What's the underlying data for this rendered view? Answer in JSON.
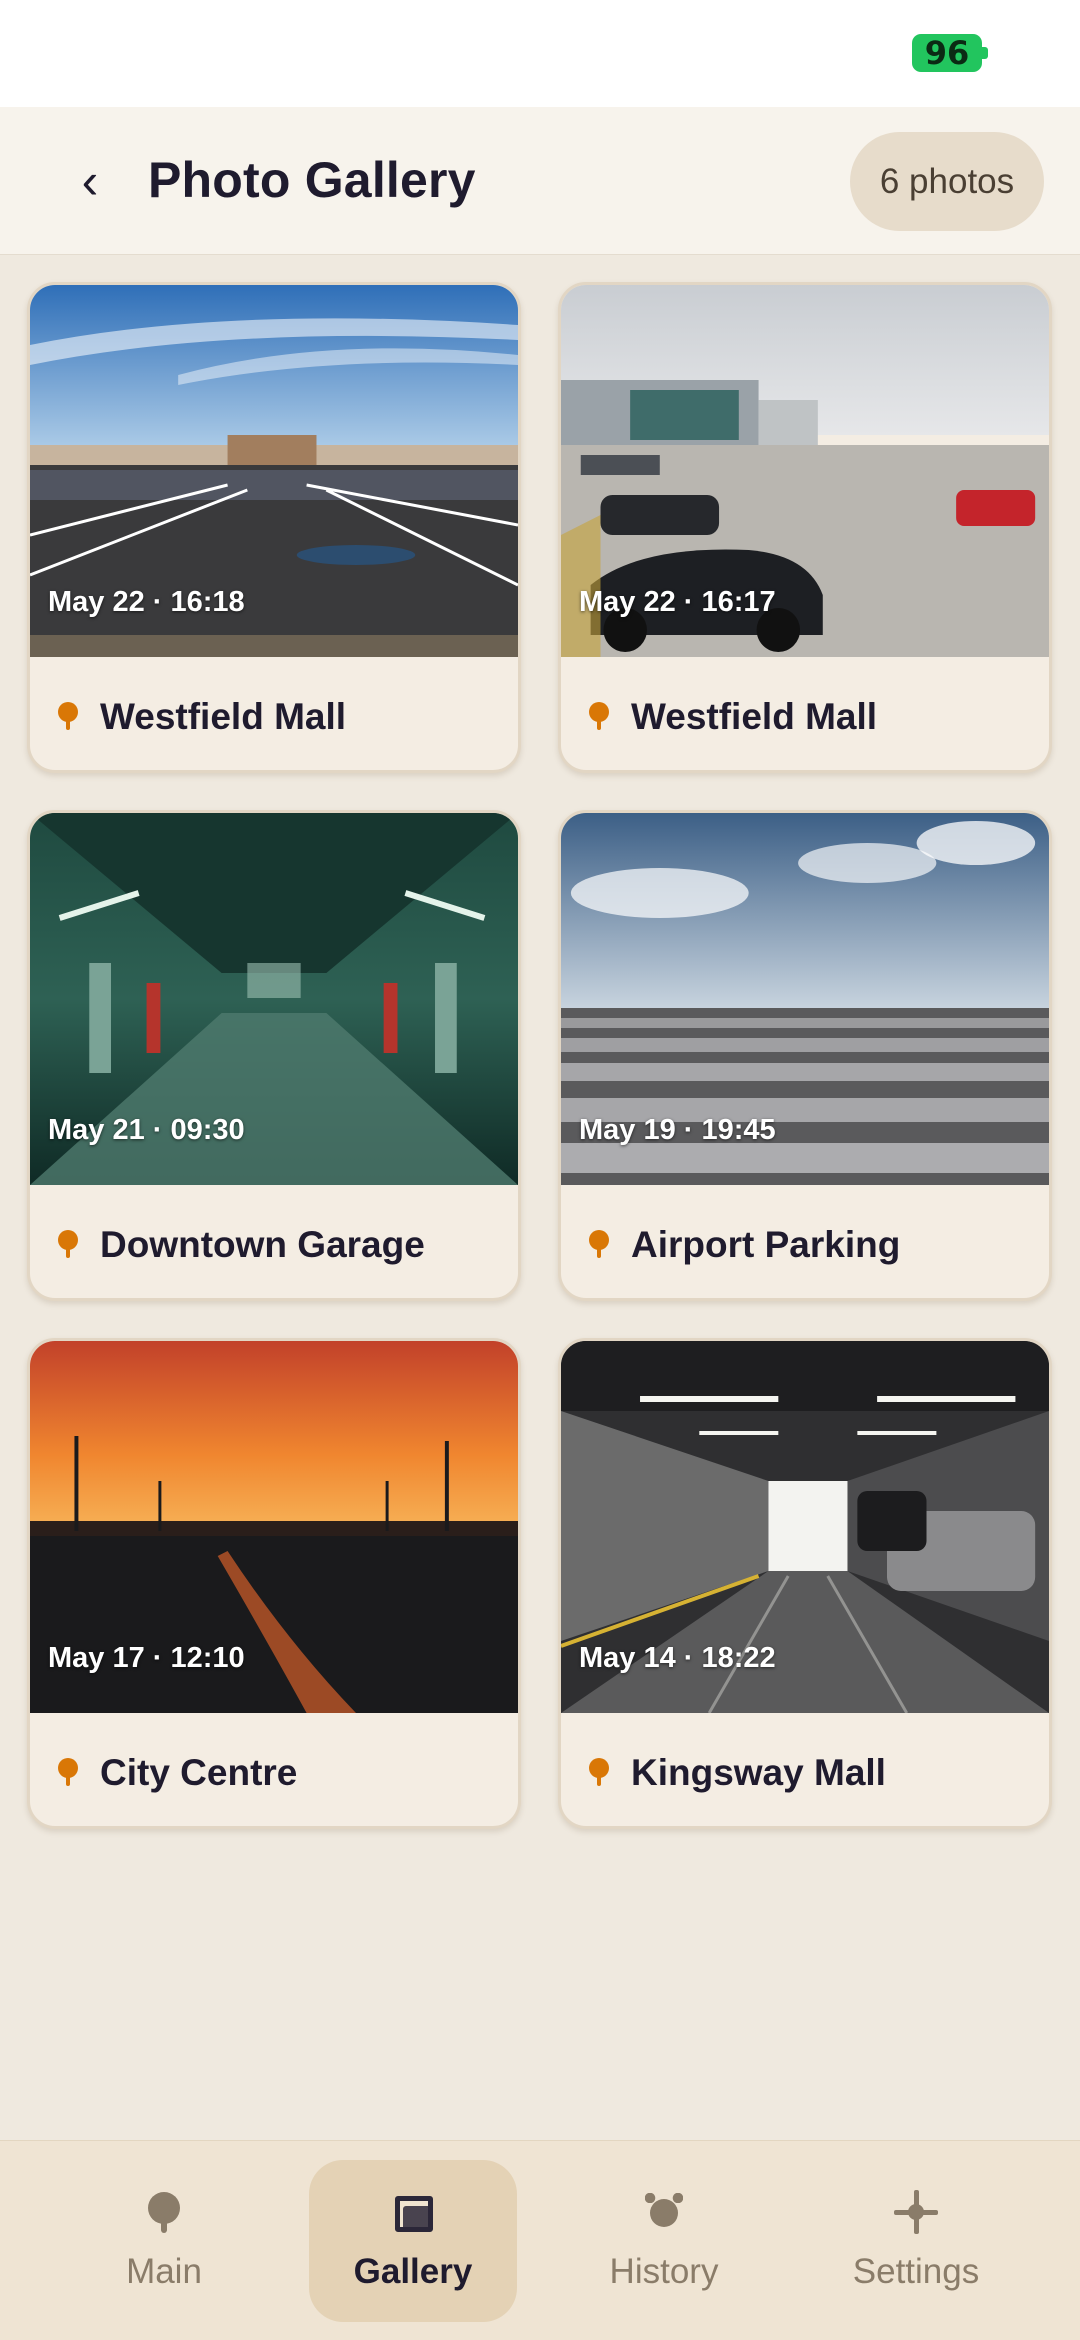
{
  "status_bar": {
    "battery": "96"
  },
  "header": {
    "back_label": "‹",
    "title": "Photo Gallery",
    "count_badge": "6 photos"
  },
  "photos": [
    {
      "date": "May 22 · 16:18",
      "place": "Westfield Mall",
      "scene": "mall-lot-blue-sky"
    },
    {
      "date": "May 22 · 16:17",
      "place": "Westfield Mall",
      "scene": "mall-lot-cloudy"
    },
    {
      "date": "May 21 · 09:30",
      "place": "Downtown Garage",
      "scene": "green-garage"
    },
    {
      "date": "May 19 · 19:45",
      "place": "Airport Parking",
      "scene": "airport-lot"
    },
    {
      "date": "May 17 · 12:10",
      "place": "City Centre",
      "scene": "sunset-lot"
    },
    {
      "date": "May 14 · 18:22",
      "place": "Kingsway Mall",
      "scene": "underground-tunnel"
    }
  ],
  "nav": {
    "items": [
      {
        "label": "Main",
        "icon": "pin-icon",
        "active": false
      },
      {
        "label": "Gallery",
        "icon": "gallery-icon",
        "active": true
      },
      {
        "label": "History",
        "icon": "alarm-clock-icon",
        "active": false
      },
      {
        "label": "Settings",
        "icon": "crosshair-icon",
        "active": false
      }
    ]
  },
  "colors": {
    "accent_pin": "#d97706",
    "battery": "#22c55e",
    "nav_active_bg": "#e4d2b5"
  }
}
